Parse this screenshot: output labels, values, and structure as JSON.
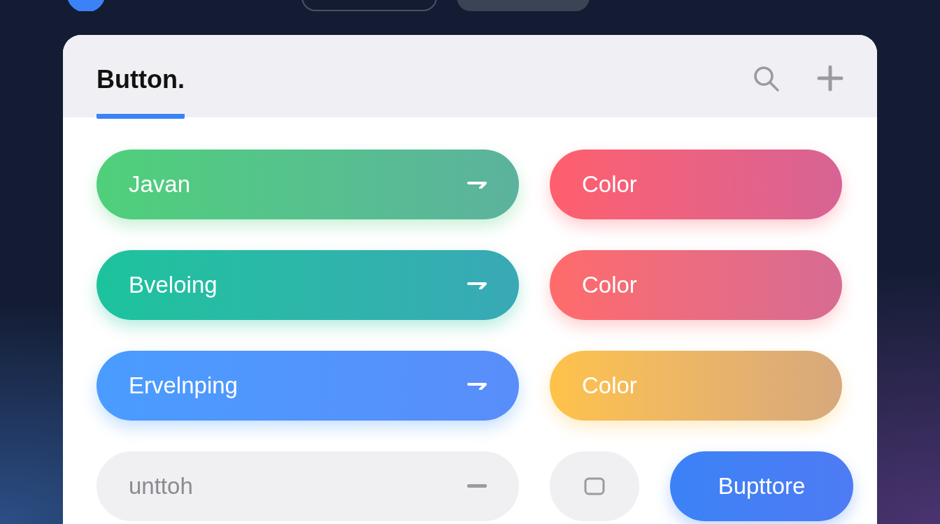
{
  "tabs": [
    {
      "label": "Button.",
      "selected": true
    }
  ],
  "rows": [
    {
      "buttons": [
        {
          "kind": "wide",
          "label": "Javan",
          "color": "#4fd07a",
          "disabled": false
        },
        {
          "kind": "half",
          "label": "Color",
          "color": "#ff5f6d",
          "disabled": false
        }
      ]
    },
    {
      "buttons": [
        {
          "kind": "wide",
          "label": "Bveloing",
          "color": "#1cc39c",
          "disabled": false
        },
        {
          "kind": "half",
          "label": "Color",
          "color": "#ff6b6b",
          "disabled": false
        }
      ]
    },
    {
      "buttons": [
        {
          "kind": "wide",
          "label": "Ervelnping",
          "color": "#4a9cff",
          "disabled": false
        },
        {
          "kind": "half",
          "label": "Color",
          "color": "#ffc24a",
          "disabled": false
        }
      ]
    },
    {
      "buttons": [
        {
          "kind": "wide",
          "label": "unttoh",
          "color": "#f0f0f3",
          "disabled": true
        },
        {
          "kind": "icon",
          "color": "#f0f0f3",
          "disabled": true
        },
        {
          "kind": "small",
          "label": "Bupttore",
          "color": "#3b82f6",
          "disabled": false
        }
      ]
    }
  ]
}
